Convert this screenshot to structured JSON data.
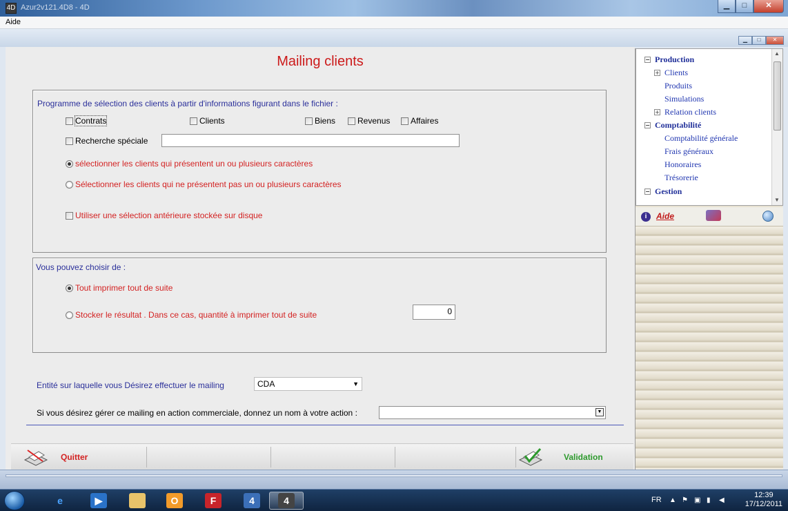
{
  "window": {
    "title": "Azur2v121.4D8 - 4D",
    "app_icon": "4D"
  },
  "menubar": {
    "aide": "Aide"
  },
  "form": {
    "title": "Mailing clients",
    "selection": {
      "heading": "Programme de sélection des clients à partir d'informations figurant dans le fichier :",
      "checkboxes": {
        "contrats": "Contrats",
        "clients": "Clients",
        "biens": "Biens",
        "revenus": "Revenus",
        "affaires": "Affaires",
        "recherche": "Recherche spéciale"
      },
      "recherche_value": "",
      "radio_present": "sélectionner les clients qui présentent un ou plusieurs caractères",
      "radio_not_present": "Sélectionner les clients qui ne présentent pas un ou plusieurs caractères",
      "use_previous": "Utiliser une sélection antérieure stockée sur disque"
    },
    "output": {
      "heading": "Vous pouvez choisir de :",
      "print_now": "Tout imprimer tout de suite",
      "store": "Stocker le résultat . Dans ce cas, quantité à imprimer tout de suite",
      "quantity": "0"
    },
    "entity_label": "Entité sur laquelle vous Désirez effectuer le mailing",
    "entity_value": "CDA",
    "action_label": "Si vous désirez gérer ce mailing en action commerciale, donnez un nom à votre action :",
    "action_value": "",
    "quit_label": "Quitter",
    "validate_label": "Validation",
    "colors": {
      "title_red": "#cc1a1a",
      "quit_red": "#d32222",
      "valid_green": "#2e9a2e",
      "label_blue": "#2a2f9a"
    }
  },
  "sidebar": {
    "tree": [
      {
        "label": "Production",
        "level": 0,
        "expander": "minus"
      },
      {
        "label": "Clients",
        "level": 1,
        "expander": "plus"
      },
      {
        "label": "Produits",
        "level": 1,
        "expander": "none"
      },
      {
        "label": "Simulations",
        "level": 1,
        "expander": "none"
      },
      {
        "label": "Relation clients",
        "level": 1,
        "expander": "plus"
      },
      {
        "label": "Comptabilité",
        "level": 0,
        "expander": "minus"
      },
      {
        "label": "Comptabilité générale",
        "level": 1,
        "expander": "none"
      },
      {
        "label": "Frais généraux",
        "level": 1,
        "expander": "none"
      },
      {
        "label": "Honoraires",
        "level": 1,
        "expander": "none"
      },
      {
        "label": "Trésorerie",
        "level": 1,
        "expander": "none"
      },
      {
        "label": "Gestion",
        "level": 0,
        "expander": "minus"
      }
    ],
    "help_label": "Aide"
  },
  "taskbar": {
    "lang": "FR",
    "time": "12:39",
    "date": "17/12/2011"
  }
}
